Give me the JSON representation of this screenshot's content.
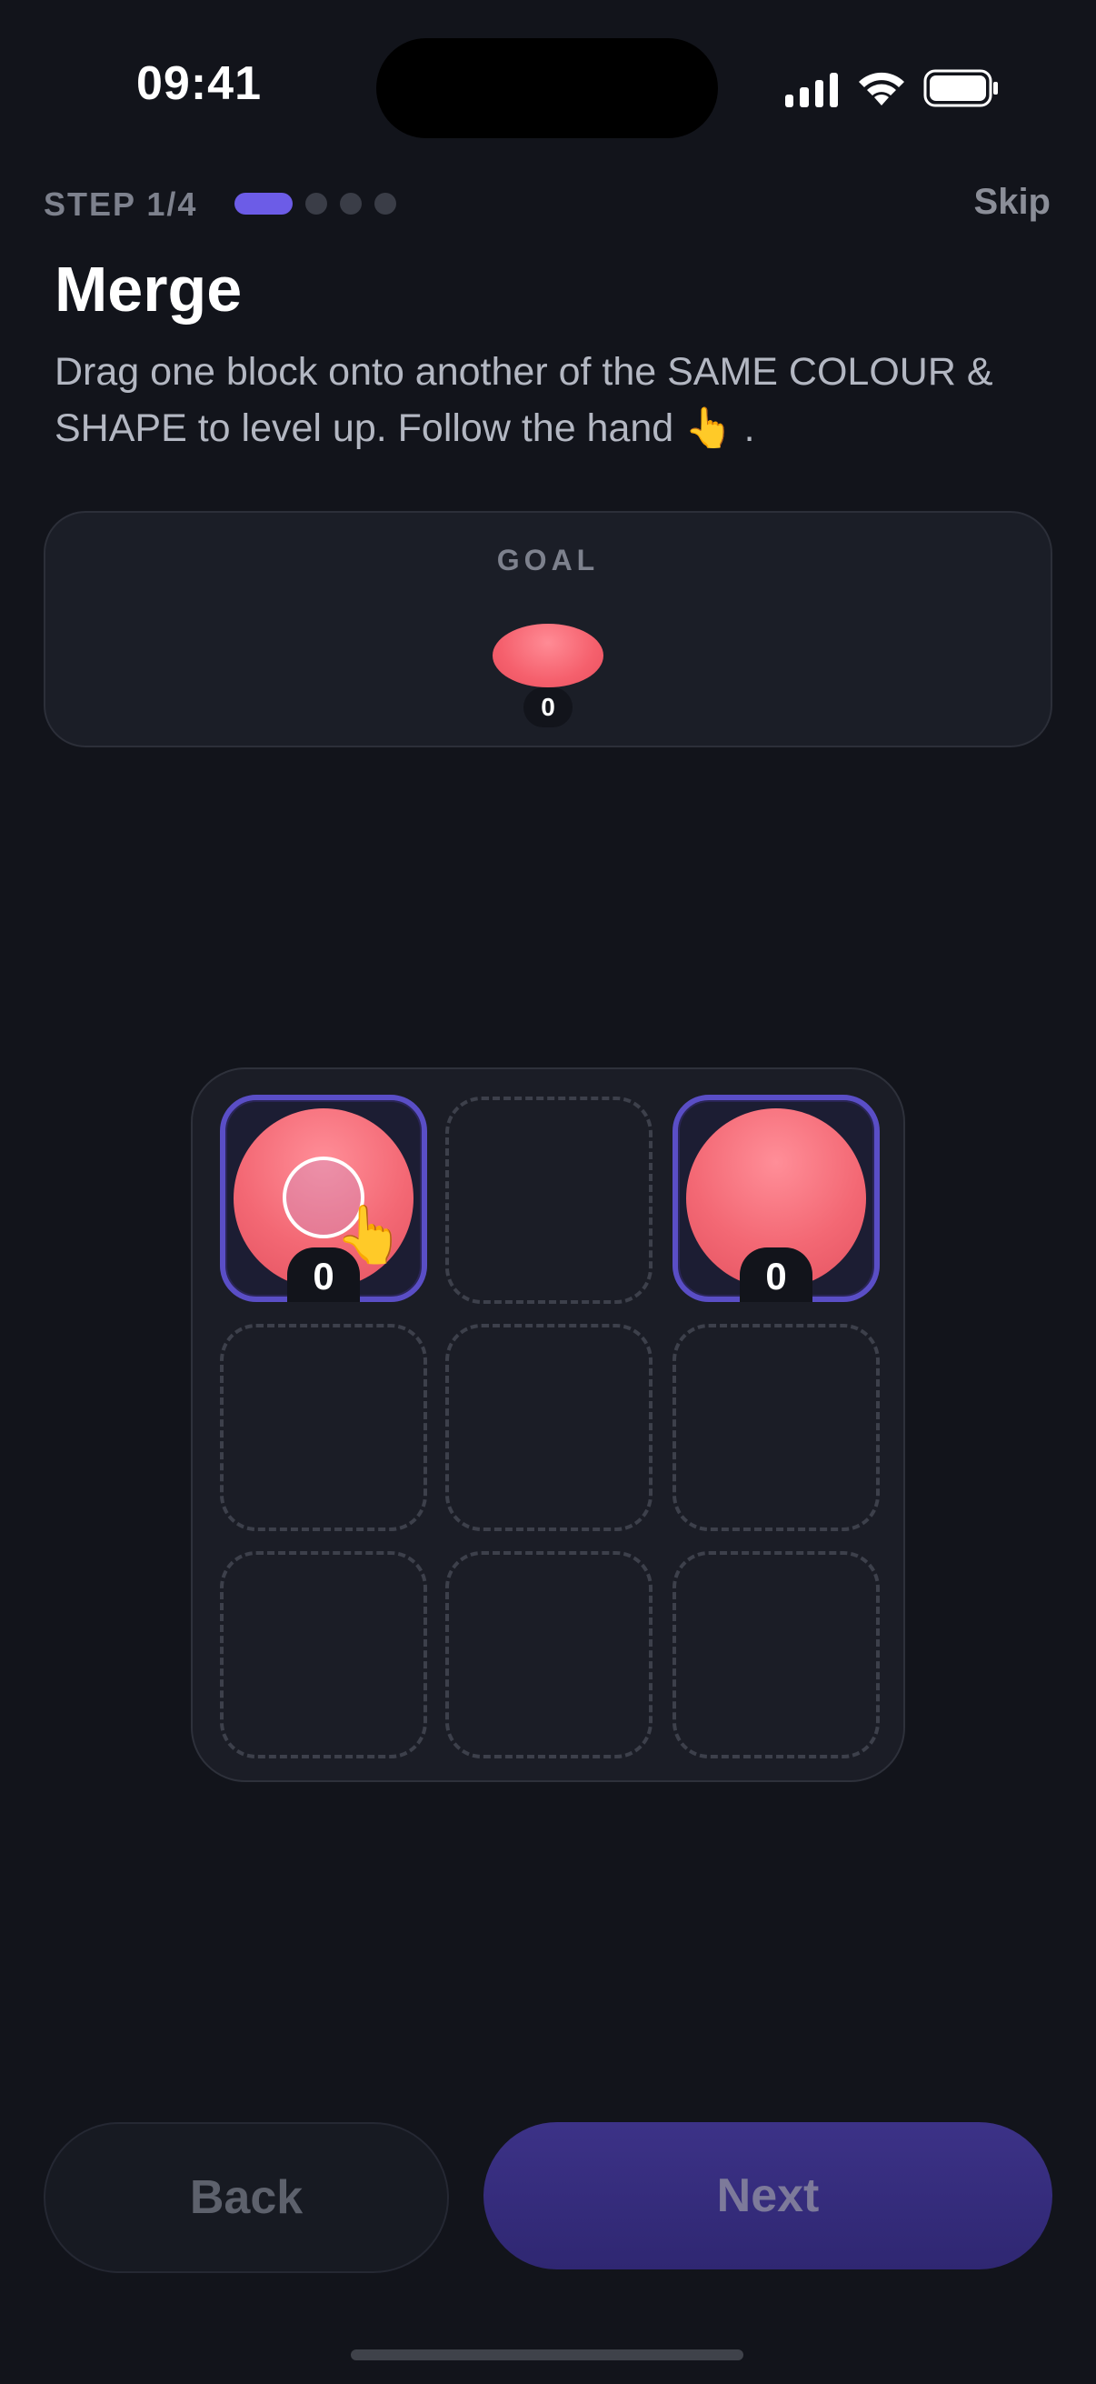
{
  "status_bar": {
    "time": "09:41"
  },
  "header": {
    "step_label": "STEP 1/4",
    "skip_label": "Skip",
    "progress": {
      "current": 1,
      "total": 4
    }
  },
  "intro": {
    "title": "Merge",
    "description": "Drag one block onto another of the SAME COLOUR & SHAPE to level up. Follow the hand 👆 ."
  },
  "goal": {
    "label": "GOAL",
    "level": "0",
    "color": "#f5606d"
  },
  "board": {
    "rows": 3,
    "cols": 3,
    "tiles": [
      {
        "level": "0",
        "color": "#f36874",
        "highlighted": true
      },
      {
        "level": "0",
        "color": "#f36874",
        "highlighted": true
      }
    ],
    "hint_icon": "pointing-hand-icon",
    "hint_glyph": "👆"
  },
  "footer": {
    "back_label": "Back",
    "next_label": "Next"
  },
  "colors": {
    "accent": "#6c5ce7",
    "background": "#12141b"
  }
}
